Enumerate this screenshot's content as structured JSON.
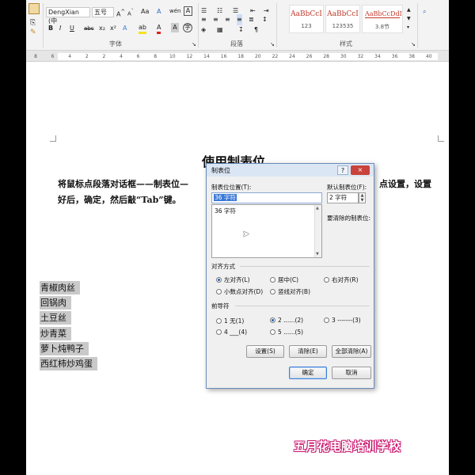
{
  "ribbon": {
    "font_name": "DengXian (中",
    "font_size": "五号",
    "format_buttons": [
      "B",
      "I",
      "U",
      "abc",
      "x₂",
      "x²"
    ],
    "group_font": "字体",
    "group_paragraph": "段落",
    "group_styles": "样式",
    "styles": [
      {
        "sample": "AaBbCcI",
        "name": "123"
      },
      {
        "sample": "AaBbCcI",
        "name": "123535"
      },
      {
        "sample": "AaBbCcDdI",
        "name": "3.8节"
      }
    ]
  },
  "ruler": {
    "labels": [
      "8",
      "6",
      "4",
      "2",
      "2",
      "4",
      "6",
      "8",
      "10",
      "12",
      "14",
      "16",
      "18",
      "20",
      "22",
      "24",
      "26",
      "28",
      "30",
      "32",
      "34",
      "36",
      "38",
      "40"
    ]
  },
  "document": {
    "title": "使用制表位",
    "line1_left": "将鼠标点段落对话框——制表位—",
    "line1_right": "点设置，设置",
    "line2": "好后，确定，然后敲“Tab”键。",
    "list": [
      "青椒肉丝",
      "回锅肉",
      "土豆丝",
      "炒青菜",
      "萝卜炖鸭子",
      "西红柿炒鸡蛋"
    ]
  },
  "dialog": {
    "title": "制表位",
    "help": "?",
    "close": "×",
    "tab_position_label": "制表位位置(T):",
    "tab_position_value": "36 字符",
    "tab_list": [
      "36 字符"
    ],
    "default_tab_label": "默认制表位(F):",
    "default_tab_value": "2 字符",
    "to_clear_label": "要清除的制表位:",
    "alignment_label": "对齐方式",
    "alignment_options": [
      "左对齐(L)",
      "居中(C)",
      "右对齐(R)",
      "小数点对齐(D)",
      "竖线对齐(B)"
    ],
    "alignment_selected": "左对齐(L)",
    "leader_label": "前导符",
    "leader_options": [
      "1 无(1)",
      "2 ......(2)",
      "3 -------(3)",
      "4 ___(4)",
      "5 ......(5)"
    ],
    "leader_selected": "2 ......(2)",
    "set_button": "设置(S)",
    "clear_button": "清除(E)",
    "clear_all_button": "全部清除(A)",
    "ok_button": "确定",
    "cancel_button": "取消"
  },
  "watermark": "五月花电脑培训学校"
}
